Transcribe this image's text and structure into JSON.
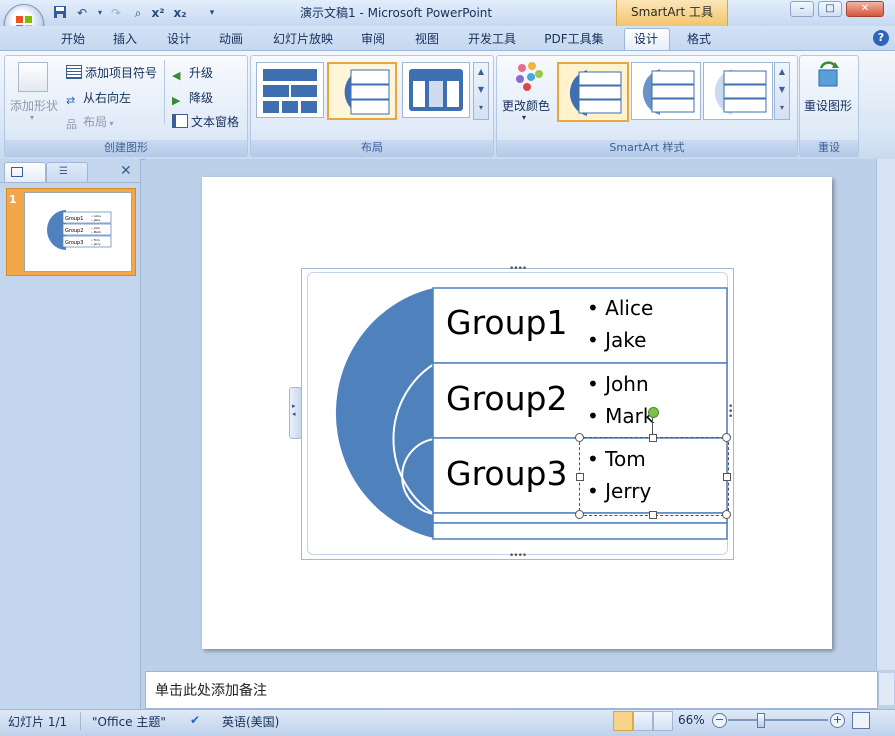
{
  "window": {
    "title": "演示文稿1 - Microsoft PowerPoint",
    "contextual_tab": "SmartArt 工具"
  },
  "tabs": [
    "开始",
    "插入",
    "设计",
    "动画",
    "幻灯片放映",
    "审阅",
    "视图",
    "开发工具",
    "PDF工具集",
    "设计",
    "格式"
  ],
  "active_tab_index": 9,
  "ribbon": {
    "create_group": {
      "label": "创建图形",
      "add_shape": "添加形状",
      "add_bullet": "添加项目符号",
      "right_to_left": "从右向左",
      "layout": "布局",
      "promote": "升级",
      "demote": "降级",
      "text_pane": "文本窗格"
    },
    "layouts_group": {
      "label": "布局"
    },
    "styles_group": {
      "label": "SmartArt 样式",
      "change_colors": "更改颜色"
    },
    "reset_group": {
      "label": "重设",
      "reset_graphic": "重设图形"
    }
  },
  "slide_pane": {
    "slide_number": "1"
  },
  "smartart": {
    "groups": [
      {
        "title": "Group1",
        "items": [
          "Alice",
          "Jake"
        ]
      },
      {
        "title": "Group2",
        "items": [
          "John",
          "Mark"
        ]
      },
      {
        "title": "Group3",
        "items": [
          "Tom",
          "Jerry"
        ]
      }
    ],
    "bullet_char": "•",
    "handle_dots": "••••"
  },
  "notes": {
    "placeholder": "单击此处添加备注"
  },
  "statusbar": {
    "slide_info": "幻灯片 1/1",
    "theme": "\"Office 主题\"",
    "language": "英语(美国)",
    "zoom": "66%"
  },
  "colors": {
    "accent": "#4f81bd",
    "ribbon_bg": "#dbe7f6",
    "selected": "#e9a63c"
  }
}
